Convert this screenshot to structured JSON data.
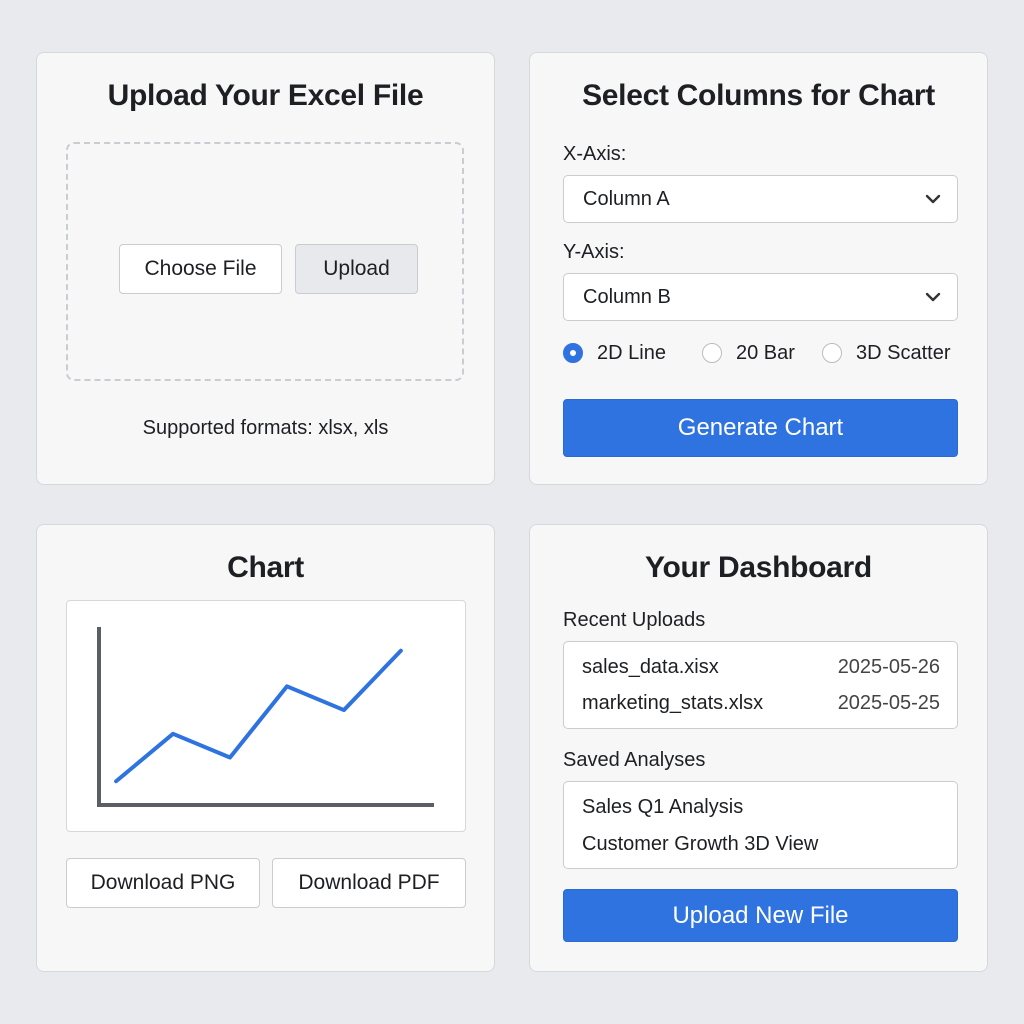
{
  "upload": {
    "title": "Upload Your Excel File",
    "choose_label": "Choose File",
    "upload_label": "Upload",
    "formats_note": "Supported formats: xlsx, xls"
  },
  "select": {
    "title": "Select Columns for Chart",
    "x_label": "X-Axis:",
    "x_value": "Column A",
    "y_label": "Y-Axis:",
    "y_value": "Column B",
    "chart_types": [
      {
        "label": "2D Line",
        "selected": true
      },
      {
        "label": "20 Bar",
        "selected": false
      },
      {
        "label": "3D Scatter",
        "selected": false
      }
    ],
    "generate_label": "Generate Chart"
  },
  "chart_panel": {
    "title": "Chart",
    "download_png_label": "Download PNG",
    "download_pdf_label": "Download PDF"
  },
  "chart_data": {
    "type": "line",
    "x": [
      1,
      2,
      3,
      4,
      5,
      6
    ],
    "y": [
      10,
      30,
      20,
      50,
      40,
      65
    ],
    "xlim": [
      0.7,
      6.6
    ],
    "ylim": [
      0,
      75
    ],
    "line_color": "#2e73e0",
    "axis_color": "#5a5f66"
  },
  "dashboard": {
    "title": "Your Dashboard",
    "recent_label": "Recent Uploads",
    "recent": [
      {
        "name": "sales_data.xisx",
        "date": "2025-05-26"
      },
      {
        "name": "marketing_stats.xlsx",
        "date": "2025-05-25"
      }
    ],
    "saved_label": "Saved Analyses",
    "saved": [
      {
        "name": "Sales Q1 Analysis"
      },
      {
        "name": "Customer Growth 3D View"
      }
    ],
    "upload_new_label": "Upload New File"
  },
  "colors": {
    "accent": "#2e73e0",
    "background": "#e9eaed",
    "panel": "#f7f7f8"
  }
}
